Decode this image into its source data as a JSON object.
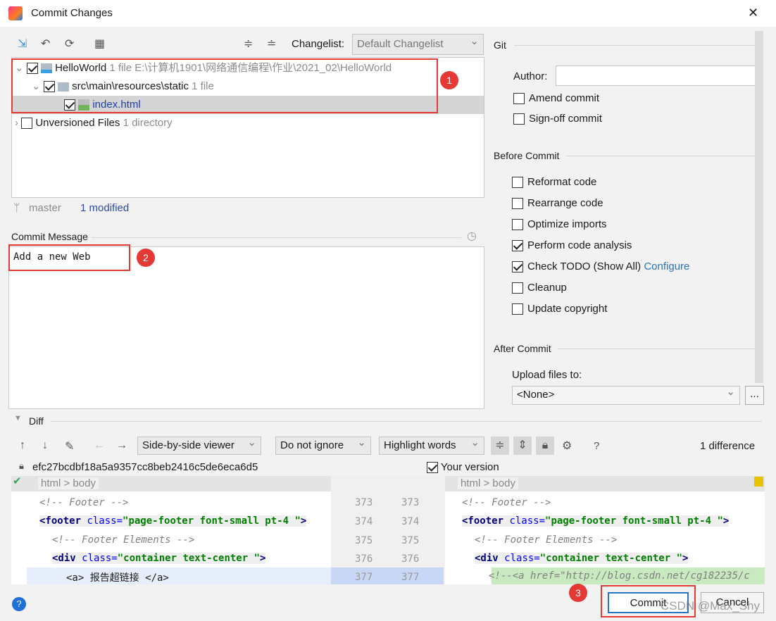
{
  "window": {
    "title": "Commit Changes",
    "close": "✕"
  },
  "toolbar": {
    "changelist_label": "Changelist:",
    "changelist_value": "Default Changelist"
  },
  "tree": [
    {
      "name": "HelloWorld",
      "meta": "1 file  E:\\计算机1901\\网络通信编程\\作业\\2021_02\\HelloWorld",
      "checked": true
    },
    {
      "name": "src\\main\\resources\\static",
      "meta": "1 file",
      "checked": true
    },
    {
      "name": "index.html",
      "meta": "",
      "checked": true
    },
    {
      "name": "Unversioned Files",
      "meta": "1 directory",
      "checked": false
    }
  ],
  "status": {
    "branch": "master",
    "modified": "1 modified"
  },
  "commit_message": {
    "label": "Commit Message",
    "value": "Add a new Web"
  },
  "annotations": [
    "1",
    "2",
    "3"
  ],
  "git": {
    "section": "Git",
    "author_label": "Author:",
    "author_value": "",
    "amend": "Amend commit",
    "signoff": "Sign-off commit",
    "before_commit": "Before Commit",
    "before_options": [
      {
        "label": "Reformat code",
        "checked": false
      },
      {
        "label": "Rearrange code",
        "checked": false
      },
      {
        "label": "Optimize imports",
        "checked": false
      },
      {
        "label": "Perform code analysis",
        "checked": true
      },
      {
        "label": "Check TODO (Show All)",
        "checked": true
      },
      {
        "label": "Cleanup",
        "checked": false
      },
      {
        "label": "Update copyright",
        "checked": false
      }
    ],
    "configure_link": "Configure",
    "after_commit": "After Commit",
    "upload_label": "Upload files to:",
    "upload_value": "<None>",
    "more": "..."
  },
  "diff": {
    "section": "Diff",
    "viewer": "Side-by-side viewer",
    "ignore": "Do not ignore",
    "highlight": "Highlight words",
    "help": "?",
    "count": "1 difference",
    "left_rev": "efc27bcdbf18a5a9357cc8beb2416c5de6eca6d5",
    "right_rev": "Your version",
    "breadcrumb_left": "html > body",
    "breadcrumb_right": "html > body",
    "line_numbers": [
      "373",
      "374",
      "375",
      "376",
      "377"
    ],
    "left_lines": [
      "<!-- Footer -->",
      "<footer class=\"page-footer font-small pt-4 \">",
      "<!-- Footer Elements -->",
      "<div class=\"container text-center \">",
      "<a> 报告超链接 </a>"
    ],
    "right_last": "<!--<a href=\"http://blog.csdn.net/cg182235/c"
  },
  "buttons": {
    "commit": "Commit",
    "cancel": "Cancel",
    "help": "?"
  },
  "watermark": "CSDN @Max_Shy",
  "colors": {
    "accent": "#2675bf",
    "annotation": "#e53935",
    "added": "#c9e9c0"
  }
}
